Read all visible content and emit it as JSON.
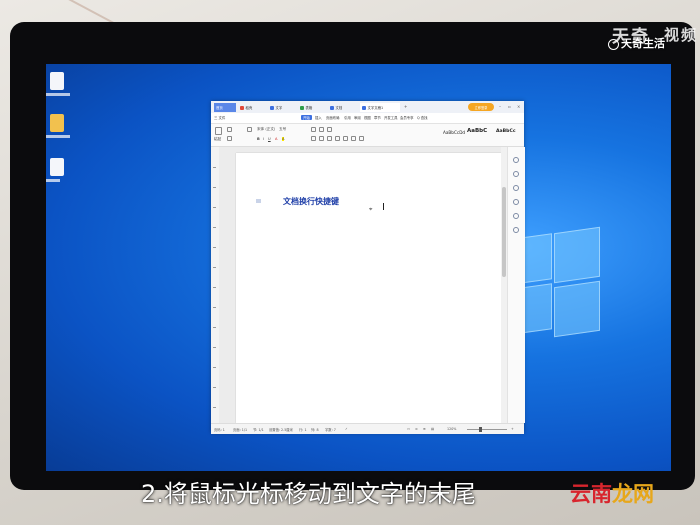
{
  "wps": {
    "tabs": [
      {
        "label": "首页",
        "kind": "home"
      },
      {
        "label": "稻壳",
        "kind": "normal",
        "color": "#e0483a"
      },
      {
        "label": "文字",
        "kind": "normal",
        "color": "#3c6fe0"
      },
      {
        "label": "表格",
        "kind": "normal",
        "color": "#2f9d4a"
      },
      {
        "label": "文档",
        "kind": "normal",
        "color": "#3c6fe0"
      },
      {
        "label": "文字文稿1",
        "kind": "active",
        "color": "#3c6fe0"
      }
    ],
    "login_label": "立即登录",
    "menus": [
      "三 文件",
      "开始",
      "插入",
      "页面布局",
      "引用",
      "审阅",
      "视图",
      "章节",
      "开发工具",
      "会员专享",
      "Q 查找"
    ],
    "active_menu_index": 1,
    "toolbar": {
      "paste": "粘贴",
      "font_name": "宋体 (正文)",
      "font_size": "五号",
      "styles": [
        "AaBbCcDd",
        "AaBbC",
        "AaBbCc"
      ]
    },
    "document_text": "文档换行快捷键",
    "status": {
      "page": "页码: 1",
      "pages": "页面: 1/1",
      "section": "节: 1/1",
      "setting": "设置值: 2.5厘米",
      "row": "行: 1",
      "col": "列: 8",
      "words": "字数: 7",
      "zoom": "120%"
    }
  },
  "watermark": {
    "top": "天奇",
    "badge": "天奇生活",
    "side": "视频"
  },
  "subtitle": "2.将鼠标光标移动到文字的末尾",
  "corner_logo": {
    "part1": "云南",
    "part2": "龙网"
  },
  "colors": {
    "desktop_blue": "#1673e0",
    "accent": "#3c6fe0",
    "doc_text": "#1f3fa8"
  }
}
